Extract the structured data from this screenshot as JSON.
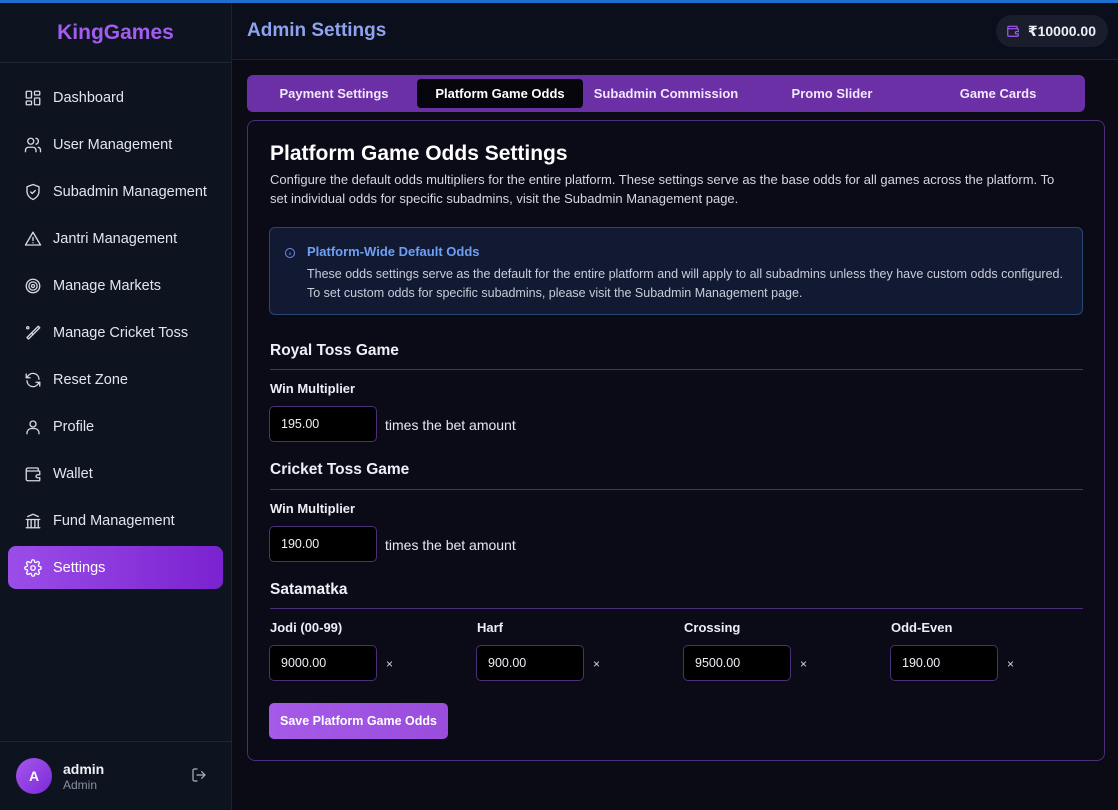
{
  "brand": "KingGames",
  "sidebar": {
    "items": [
      {
        "label": "Dashboard",
        "icon": "grid-icon"
      },
      {
        "label": "User Management",
        "icon": "users-icon"
      },
      {
        "label": "Subadmin Management",
        "icon": "shield-icon"
      },
      {
        "label": "Jantri Management",
        "icon": "alert-triangle-icon"
      },
      {
        "label": "Manage Markets",
        "icon": "target-icon"
      },
      {
        "label": "Manage Cricket Toss",
        "icon": "cricket-bat-icon"
      },
      {
        "label": "Reset Zone",
        "icon": "refresh-icon"
      },
      {
        "label": "Profile",
        "icon": "user-icon"
      },
      {
        "label": "Wallet",
        "icon": "wallet-icon"
      },
      {
        "label": "Fund Management",
        "icon": "bank-icon"
      },
      {
        "label": "Settings",
        "icon": "gear-icon",
        "active": true
      }
    ]
  },
  "user": {
    "initial": "A",
    "name": "admin",
    "role": "Admin"
  },
  "header": {
    "title": "Admin Settings",
    "balance": "₹10000.00"
  },
  "tabs": [
    {
      "label": "Payment Settings"
    },
    {
      "label": "Platform Game Odds",
      "active": true
    },
    {
      "label": "Subadmin Commission"
    },
    {
      "label": "Promo Slider"
    },
    {
      "label": "Game Cards"
    }
  ],
  "main": {
    "title": "Platform Game Odds Settings",
    "description": "Configure the default odds multipliers for the entire platform. These settings serve as the base odds for all games across the platform. To set individual odds for specific subadmins, visit the Subadmin Management page.",
    "info": {
      "title": "Platform-Wide Default Odds",
      "text": "These odds settings serve as the default for the entire platform and will apply to all subadmins unless they have custom odds configured. To set custom odds for specific subadmins, please visit the Subadmin Management page."
    },
    "royal_toss": {
      "title": "Royal Toss Game",
      "label": "Win Multiplier",
      "value": "195.00",
      "suffix": "times the bet amount"
    },
    "cricket_toss": {
      "title": "Cricket Toss Game",
      "label": "Win Multiplier",
      "value": "190.00",
      "suffix": "times the bet amount"
    },
    "satamatka": {
      "title": "Satamatka",
      "fields": [
        {
          "label": "Jodi (00-99)",
          "value": "9000.00",
          "unit": "×"
        },
        {
          "label": "Harf",
          "value": "900.00",
          "unit": "×"
        },
        {
          "label": "Crossing",
          "value": "9500.00",
          "unit": "×"
        },
        {
          "label": "Odd-Even",
          "value": "190.00",
          "unit": "×"
        }
      ]
    },
    "save_label": "Save Platform Game Odds"
  }
}
